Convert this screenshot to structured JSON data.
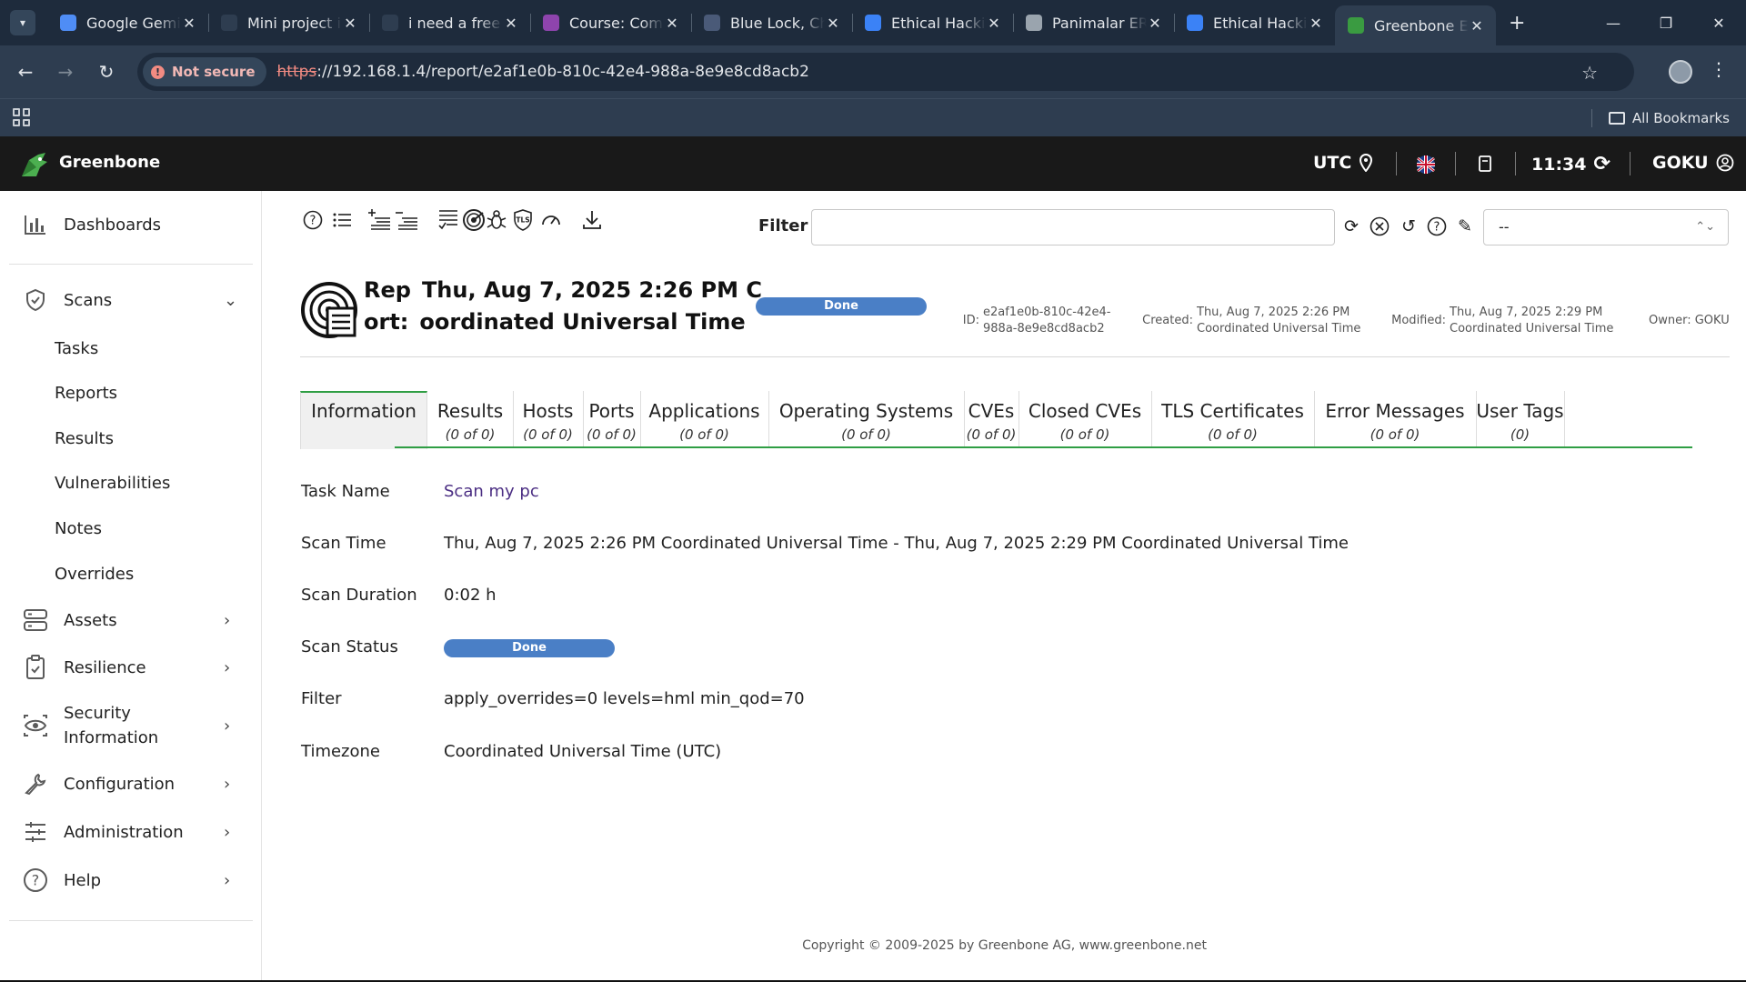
{
  "browser": {
    "tabs": [
      {
        "title": "Google Gemini",
        "icon": "gemini-icon",
        "color": "#4f8df5"
      },
      {
        "title": "Mini project ideas",
        "icon": "chatgpt-icon",
        "color": "#2e3d50"
      },
      {
        "title": "i need a free",
        "icon": "openai-icon",
        "color": "#2e3d50"
      },
      {
        "title": "Course: Computer",
        "icon": "moodle-icon",
        "color": "#8e44ad"
      },
      {
        "title": "Blue Lock, Ch",
        "icon": "manga-icon",
        "color": "#4a5a78"
      },
      {
        "title": "Ethical Hacking",
        "icon": "sololearn-icon",
        "color": "#3b82f6"
      },
      {
        "title": "Panimalar ERP",
        "icon": "college-icon",
        "color": "#9aa4ae"
      },
      {
        "title": "Ethical Hacking",
        "icon": "sololearn-icon",
        "color": "#3b82f6"
      },
      {
        "title": "Greenbone Enterprise",
        "icon": "greenbone-icon",
        "color": "#3a9b41",
        "active": true
      }
    ],
    "not_secure_label": "Not secure",
    "url_protocol": "https",
    "url_rest": "://192.168.1.4/report/e2af1e0b-810c-42e4-988a-8e9e8cd8acb2",
    "all_bookmarks_label": "All Bookmarks"
  },
  "app": {
    "brand": "Greenbone",
    "timezone_label": "UTC",
    "time": "11:34",
    "user": "GOKU"
  },
  "sidebar": {
    "dashboards": "Dashboards",
    "scans": "Scans",
    "scan_items": [
      "Tasks",
      "Reports",
      "Results",
      "Vulnerabilities",
      "Notes",
      "Overrides"
    ],
    "assets": "Assets",
    "resilience": "Resilience",
    "security_info_line1": "Security",
    "security_info_line2": "Information",
    "configuration": "Configuration",
    "administration": "Administration",
    "help": "Help"
  },
  "filter": {
    "label": "Filter",
    "value": "",
    "selected": "--"
  },
  "report": {
    "title_line1_a": "Rep",
    "title_line1_b": "Thu, Aug 7, 2025 2:26 PM C",
    "title_line2_a": "ort:",
    "title_line2_b": "oordinated Universal Time",
    "status": "Done",
    "id_label": "ID:",
    "id_line1": "e2af1e0b-810c-42e4-",
    "id_line2": "988a-8e9e8cd8acb2",
    "created_label": "Created:",
    "created_line1": "Thu, Aug 7, 2025 2:26 PM",
    "created_line2": "Coordinated Universal Time",
    "modified_label": "Modified:",
    "modified_line1": "Thu, Aug 7, 2025 2:29 PM",
    "modified_line2": "Coordinated Universal Time",
    "owner": "Owner: GOKU"
  },
  "tabs": [
    {
      "label": "Information",
      "count": ""
    },
    {
      "label": "Results",
      "count": "(0 of 0)"
    },
    {
      "label": "Hosts",
      "count": "(0 of 0)"
    },
    {
      "label": "Ports",
      "count": "(0 of 0)"
    },
    {
      "label": "Applications",
      "count": "(0 of 0)"
    },
    {
      "label": "Operating Systems",
      "count": "(0 of 0)"
    },
    {
      "label": "CVEs",
      "count": "(0 of 0)"
    },
    {
      "label": "Closed CVEs",
      "count": "(0 of 0)"
    },
    {
      "label": "TLS Certificates",
      "count": "(0 of 0)"
    },
    {
      "label": "Error Messages",
      "count": "(0 of 0)"
    },
    {
      "label": "User Tags",
      "count": "(0)"
    }
  ],
  "info": {
    "task_name_label": "Task Name",
    "task_name": "Scan my pc",
    "scan_time_label": "Scan Time",
    "scan_time": "Thu, Aug 7, 2025 2:26 PM Coordinated Universal Time - Thu, Aug 7, 2025 2:29 PM Coordinated Universal Time",
    "scan_duration_label": "Scan Duration",
    "scan_duration": "0:02 h",
    "scan_status_label": "Scan Status",
    "scan_status": "Done",
    "filter_label": "Filter",
    "filter": "apply_overrides=0 levels=hml min_qod=70",
    "timezone_label": "Timezone",
    "timezone": "Coordinated Universal Time (UTC)"
  },
  "footer": "Copyright © 2009-2025 by Greenbone AG, www.greenbone.net"
}
